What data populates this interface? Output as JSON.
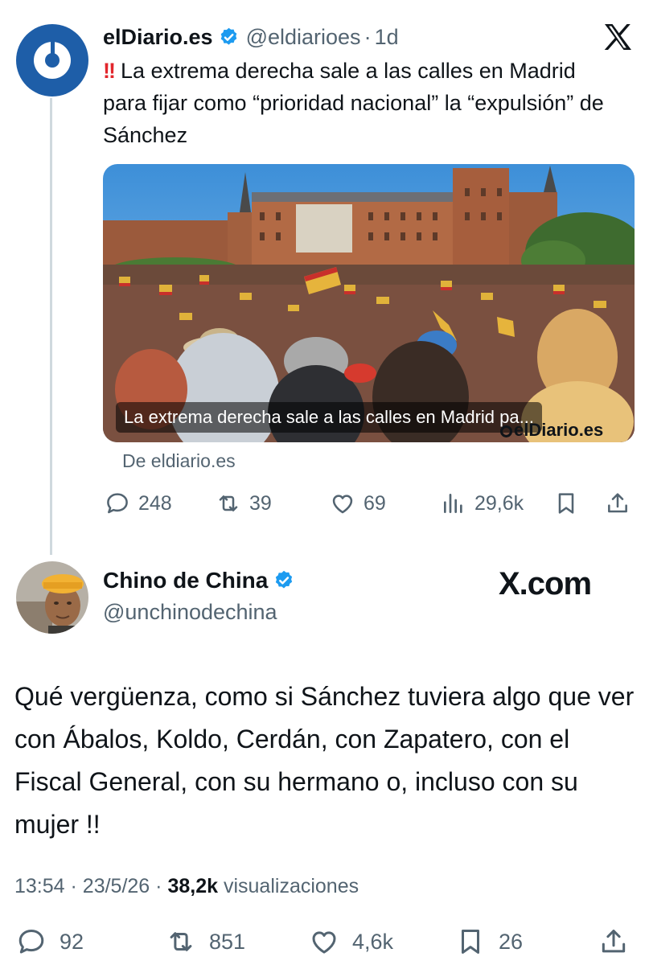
{
  "original_tweet": {
    "author_name": "elDiario.es",
    "handle": "@eldiarioes",
    "separator": "·",
    "age": "1d",
    "alert_emoji": "!!",
    "text": "La extrema derecha sale a las calles en Madrid para fijar como “prioridad nacional” la “expulsión” de Sánchez",
    "card": {
      "caption": "La extrema derecha sale a las calles en Madrid pa...",
      "brand": "elDiario.es",
      "source": "De eldiario.es"
    },
    "actions": {
      "replies": "248",
      "reposts": "39",
      "likes": "69",
      "views": "29,6k"
    }
  },
  "quote_tweet": {
    "author_name": "Chino de China",
    "handle": "@unchinodechina",
    "watermark": "X.com",
    "text": "Qué vergüenza, como si Sánchez tuviera algo que ver con Ábalos, Koldo, Cerdán, con Zapatero, con el Fiscal General, con su hermano o, incluso con su mujer !!",
    "time": "13:54",
    "date": "23/5/26",
    "views_count": "38,2k",
    "views_label": "visualizaciones",
    "actions": {
      "replies": "92",
      "reposts": "851",
      "likes": "4,6k",
      "bookmarks": "26"
    }
  },
  "icons": [
    "verified-badge-icon",
    "x-logo-icon",
    "reply-icon",
    "repost-icon",
    "like-icon",
    "views-icon",
    "bookmark-icon",
    "share-icon"
  ],
  "colors": {
    "verified": "#1d9bf0",
    "muted": "#536471",
    "text": "#0f1419",
    "brand_blue": "#1e5ea8",
    "alert": "#e2262c"
  }
}
